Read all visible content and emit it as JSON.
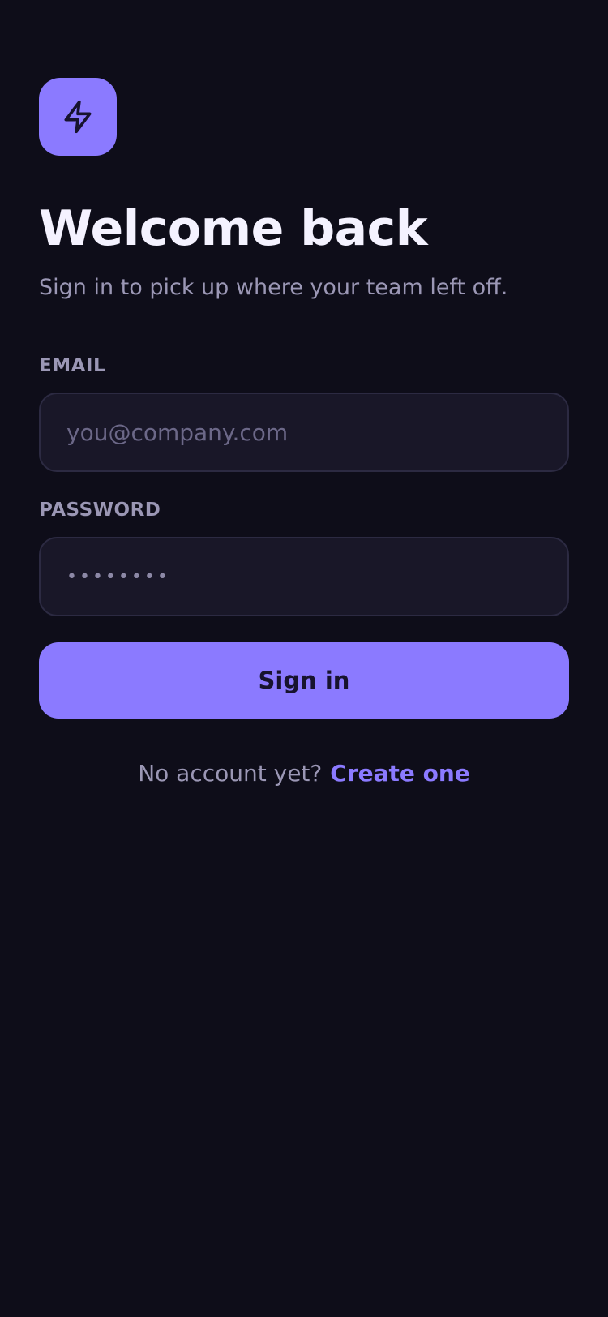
{
  "brand": {
    "logo_icon": "lightning-bolt-icon",
    "accent_color": "#8b7aff",
    "background_color": "#0e0d19"
  },
  "heading": {
    "title": "Welcome back",
    "subtitle": "Sign in to pick up where your team left off."
  },
  "form": {
    "email": {
      "label": "EMAIL",
      "placeholder": "you@company.com",
      "value": ""
    },
    "password": {
      "label": "PASSWORD",
      "value": "••••••••"
    },
    "submit_label": "Sign in"
  },
  "footer": {
    "prompt": "No account yet?",
    "link_label": "Create one"
  }
}
